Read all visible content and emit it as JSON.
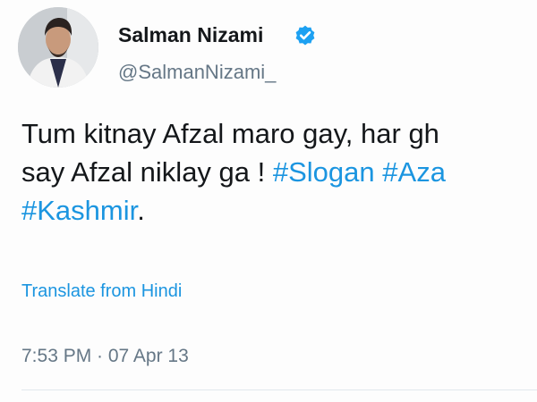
{
  "author": {
    "name": "Salman Nizami",
    "handle": "@SalmanNizami_",
    "verified": true,
    "avatar_icon": "profile-photo"
  },
  "tweet": {
    "line1": "Tum kitnay Afzal maro gay, har gh",
    "line2_text": "say Afzal niklay ga ! ",
    "line2_hashtag1": "#Slogan",
    "line2_hashtag2": "#Aza",
    "line3_hashtag": "#Kashmir",
    "line3_tail": "."
  },
  "translate_label": "Translate from Hindi",
  "timestamp": "7:53 PM · 07 Apr 13",
  "colors": {
    "link": "#1b95e0",
    "text": "#14171a",
    "muted": "#657786",
    "verified_badge": "#1da1f2"
  }
}
